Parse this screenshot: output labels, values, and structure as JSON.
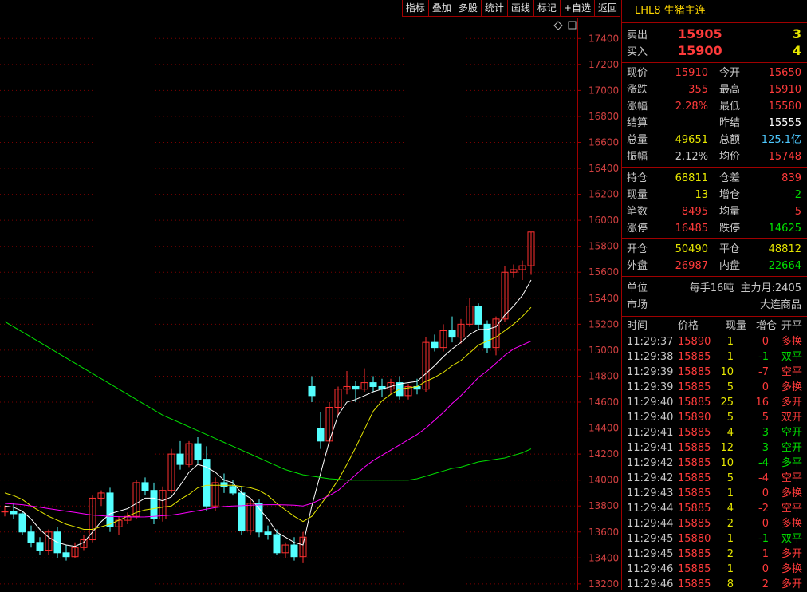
{
  "toolbar": [
    "指标",
    "叠加",
    "多股",
    "统计",
    "画线",
    "标记",
    "+自选",
    "返回"
  ],
  "chart": {
    "price_ticks": [
      "17400",
      "17200",
      "17000",
      "16800",
      "16600",
      "16400",
      "16200",
      "16000",
      "15800",
      "15600",
      "15400",
      "15200",
      "15000",
      "14800",
      "14600",
      "14400",
      "14200",
      "14000",
      "13800",
      "13600",
      "13400",
      "13200"
    ],
    "icons": [
      "diamond-icon",
      "square-icon"
    ],
    "colors": {
      "up": "#ff3030",
      "down": "#54ffff",
      "ma5": "#ffffff",
      "ma10": "#e6e600",
      "ma20": "#ff00ff",
      "ma60": "#00e000"
    }
  },
  "chart_data": {
    "type": "candlestick",
    "ylim": [
      13150,
      17500
    ],
    "candles": [
      [
        13760,
        13800,
        13720,
        13760
      ],
      [
        13760,
        13820,
        13700,
        13740
      ],
      [
        13740,
        13760,
        13580,
        13600
      ],
      [
        13600,
        13650,
        13480,
        13520
      ],
      [
        13520,
        13560,
        13420,
        13460
      ],
      [
        13460,
        13620,
        13420,
        13600
      ],
      [
        13600,
        13640,
        13400,
        13440
      ],
      [
        13440,
        13500,
        13380,
        13410
      ],
      [
        13410,
        13520,
        13400,
        13480
      ],
      [
        13480,
        13580,
        13460,
        13540
      ],
      [
        13540,
        13880,
        13520,
        13860
      ],
      [
        13860,
        13920,
        13800,
        13900
      ],
      [
        13900,
        13940,
        13600,
        13640
      ],
      [
        13640,
        13720,
        13580,
        13690
      ],
      [
        13690,
        13750,
        13660,
        13720
      ],
      [
        13720,
        14000,
        13700,
        13980
      ],
      [
        13980,
        14020,
        13880,
        13920
      ],
      [
        13920,
        13980,
        13660,
        13700
      ],
      [
        13700,
        13950,
        13680,
        13920
      ],
      [
        13920,
        14240,
        13900,
        14200
      ],
      [
        14200,
        14300,
        14080,
        14120
      ],
      [
        14120,
        14300,
        14100,
        14280
      ],
      [
        14280,
        14330,
        14120,
        14160
      ],
      [
        14160,
        14260,
        13760,
        13800
      ],
      [
        13800,
        14020,
        13760,
        13980
      ],
      [
        13980,
        14050,
        13900,
        13950
      ],
      [
        13950,
        14000,
        13880,
        13900
      ],
      [
        13900,
        13950,
        13580,
        13610
      ],
      [
        13610,
        13860,
        13580,
        13820
      ],
      [
        13820,
        13850,
        13560,
        13600
      ],
      [
        13600,
        13650,
        13540,
        13580
      ],
      [
        13580,
        13620,
        13420,
        13440
      ],
      [
        13440,
        13520,
        13400,
        13500
      ],
      [
        13500,
        13560,
        13380,
        13410
      ],
      [
        13410,
        13600,
        13360,
        13560
      ],
      [
        14720,
        14800,
        14600,
        14650
      ],
      [
        14400,
        14520,
        14240,
        14300
      ],
      [
        14300,
        14600,
        14280,
        14560
      ],
      [
        14560,
        14720,
        14500,
        14700
      ],
      [
        14700,
        14840,
        14660,
        14720
      ],
      [
        14720,
        14760,
        14600,
        14700
      ],
      [
        14700,
        14860,
        14680,
        14750
      ],
      [
        14750,
        14800,
        14680,
        14720
      ],
      [
        14720,
        14780,
        14640,
        14700
      ],
      [
        14700,
        14780,
        14660,
        14750
      ],
      [
        14750,
        14800,
        14620,
        14650
      ],
      [
        14650,
        14740,
        14620,
        14720
      ],
      [
        14720,
        14780,
        14660,
        14700
      ],
      [
        14700,
        15100,
        14680,
        15060
      ],
      [
        15060,
        15120,
        14990,
        15020
      ],
      [
        15020,
        15200,
        14990,
        15150
      ],
      [
        15150,
        15260,
        15060,
        15100
      ],
      [
        15100,
        15240,
        15050,
        15200
      ],
      [
        15200,
        15400,
        15180,
        15340
      ],
      [
        15340,
        15360,
        15160,
        15200
      ],
      [
        15200,
        15230,
        14980,
        15020
      ],
      [
        15020,
        15260,
        14960,
        15240
      ],
      [
        15240,
        15650,
        15220,
        15600
      ],
      [
        15600,
        15660,
        15560,
        15620
      ],
      [
        15620,
        15690,
        15540,
        15650
      ],
      [
        15650,
        15910,
        15580,
        15910
      ]
    ],
    "ma_series": [
      {
        "values": [
          13800,
          13790,
          13760,
          13700,
          13620,
          13560,
          13520,
          13500,
          13490,
          13520,
          13600,
          13680,
          13740,
          13760,
          13780,
          13820,
          13860,
          13860,
          13840,
          13870,
          13960,
          14060,
          14120,
          14100,
          14060,
          14000,
          13980,
          13900,
          13860,
          13780,
          13700,
          13600,
          13560,
          13520,
          13500,
          13800,
          14050,
          14300,
          14500,
          14600,
          14620,
          14650,
          14680,
          14700,
          14720,
          14740,
          14750,
          14760,
          14820,
          14880,
          14950,
          15010,
          15060,
          15120,
          15160,
          15160,
          15180,
          15270,
          15340,
          15420,
          15540
        ]
      },
      {
        "values": [
          13900,
          13880,
          13850,
          13800,
          13760,
          13720,
          13690,
          13660,
          13640,
          13620,
          13620,
          13640,
          13660,
          13690,
          13720,
          13750,
          13770,
          13780,
          13790,
          13800,
          13850,
          13890,
          13940,
          13960,
          13960,
          13960,
          13960,
          13950,
          13940,
          13920,
          13880,
          13820,
          13770,
          13720,
          13680,
          13720,
          13810,
          13900,
          14000,
          14120,
          14250,
          14390,
          14530,
          14610,
          14660,
          14700,
          14710,
          14720,
          14760,
          14790,
          14830,
          14880,
          14920,
          14980,
          15040,
          15070,
          15100,
          15150,
          15200,
          15260,
          15330
        ]
      },
      {
        "values": [
          13820,
          13815,
          13810,
          13800,
          13790,
          13780,
          13770,
          13760,
          13750,
          13740,
          13730,
          13725,
          13720,
          13718,
          13716,
          13715,
          13716,
          13720,
          13725,
          13730,
          13740,
          13752,
          13764,
          13776,
          13788,
          13796,
          13800,
          13802,
          13806,
          13808,
          13810,
          13810,
          13808,
          13806,
          13800,
          13820,
          13850,
          13880,
          13920,
          13980,
          14040,
          14100,
          14150,
          14190,
          14230,
          14270,
          14310,
          14350,
          14400,
          14460,
          14520,
          14590,
          14650,
          14720,
          14790,
          14840,
          14900,
          14960,
          15010,
          15040,
          15070
        ]
      },
      {
        "values": [
          15220,
          15180,
          15140,
          15100,
          15060,
          15020,
          14980,
          14940,
          14900,
          14860,
          14820,
          14780,
          14740,
          14700,
          14660,
          14620,
          14580,
          14540,
          14500,
          14470,
          14440,
          14410,
          14380,
          14350,
          14320,
          14290,
          14260,
          14230,
          14200,
          14170,
          14140,
          14110,
          14080,
          14060,
          14040,
          14030,
          14020,
          14010,
          14005,
          14000,
          14000,
          14000,
          14000,
          14000,
          14000,
          14000,
          14000,
          14010,
          14030,
          14050,
          14070,
          14090,
          14100,
          14120,
          14140,
          14150,
          14160,
          14170,
          14190,
          14210,
          14240
        ]
      }
    ]
  },
  "panel": {
    "title": "LHL8 生猪主连",
    "sell": {
      "label": "卖出",
      "price": "15905",
      "qty": "3"
    },
    "buy": {
      "label": "买入",
      "price": "15900",
      "qty": "4"
    },
    "quote_rows": [
      [
        {
          "t": "现价",
          "c": "lbl"
        },
        {
          "t": "15910",
          "c": "red"
        },
        {
          "t": "今开",
          "c": "lbl"
        },
        {
          "t": "15650",
          "c": "red"
        }
      ],
      [
        {
          "t": "涨跌",
          "c": "lbl"
        },
        {
          "t": "355",
          "c": "red"
        },
        {
          "t": "最高",
          "c": "lbl"
        },
        {
          "t": "15910",
          "c": "red"
        }
      ],
      [
        {
          "t": "涨幅",
          "c": "lbl"
        },
        {
          "t": "2.28%",
          "c": "red"
        },
        {
          "t": "最低",
          "c": "lbl"
        },
        {
          "t": "15580",
          "c": "red"
        }
      ],
      [
        {
          "t": "结算",
          "c": "lbl"
        },
        {
          "t": "",
          "c": "lbl"
        },
        {
          "t": "昨结",
          "c": "lbl"
        },
        {
          "t": "15555",
          "c": "white"
        }
      ],
      [
        {
          "t": "总量",
          "c": "lbl"
        },
        {
          "t": "49651",
          "c": "yellow"
        },
        {
          "t": "总额",
          "c": "lbl"
        },
        {
          "t": "125.1亿",
          "c": "cyan"
        }
      ],
      [
        {
          "t": "振幅",
          "c": "lbl"
        },
        {
          "t": "2.12%",
          "c": "lbl"
        },
        {
          "t": "均价",
          "c": "lbl"
        },
        {
          "t": "15748",
          "c": "red"
        }
      ]
    ],
    "pos_rows": [
      [
        {
          "t": "持仓",
          "c": "lbl"
        },
        {
          "t": "68811",
          "c": "yellow"
        },
        {
          "t": "仓差",
          "c": "lbl"
        },
        {
          "t": "839",
          "c": "red"
        }
      ],
      [
        {
          "t": "现量",
          "c": "lbl"
        },
        {
          "t": "13",
          "c": "yellow"
        },
        {
          "t": "增仓",
          "c": "lbl"
        },
        {
          "t": "-2",
          "c": "green"
        }
      ],
      [
        {
          "t": "笔数",
          "c": "lbl"
        },
        {
          "t": "8495",
          "c": "red"
        },
        {
          "t": "均量",
          "c": "lbl"
        },
        {
          "t": "5",
          "c": "red"
        }
      ],
      [
        {
          "t": "涨停",
          "c": "lbl"
        },
        {
          "t": "16485",
          "c": "red"
        },
        {
          "t": "跌停",
          "c": "lbl"
        },
        {
          "t": "14625",
          "c": "green"
        }
      ]
    ],
    "oc_rows": [
      [
        {
          "t": "开仓",
          "c": "lbl"
        },
        {
          "t": "50490",
          "c": "yellow"
        },
        {
          "t": "平仓",
          "c": "lbl"
        },
        {
          "t": "48812",
          "c": "yellow"
        }
      ],
      [
        {
          "t": "外盘",
          "c": "lbl"
        },
        {
          "t": "26987",
          "c": "red"
        },
        {
          "t": "内盘",
          "c": "lbl"
        },
        {
          "t": "22664",
          "c": "green"
        }
      ]
    ],
    "unit": {
      "label": "单位",
      "value": "每手16吨  主力月:2405"
    },
    "market": {
      "label": "市场",
      "value": "大连商品"
    },
    "tick_headers": [
      "时间",
      "价格",
      "现量",
      "增仓",
      "开平"
    ],
    "ticks": [
      {
        "time": "11:29:37",
        "price": "15890",
        "qty": "1",
        "chg": "0",
        "type": "多换",
        "pc": "red",
        "cc": "red",
        "tc": "red"
      },
      {
        "time": "11:29:38",
        "price": "15885",
        "qty": "1",
        "chg": "-1",
        "type": "双平",
        "pc": "red",
        "cc": "green",
        "tc": "green"
      },
      {
        "time": "11:29:39",
        "price": "15885",
        "qty": "10",
        "chg": "-7",
        "type": "空平",
        "pc": "red",
        "cc": "red",
        "tc": "red"
      },
      {
        "time": "11:29:39",
        "price": "15885",
        "qty": "5",
        "chg": "0",
        "type": "多换",
        "pc": "red",
        "cc": "red",
        "tc": "red"
      },
      {
        "time": "11:29:40",
        "price": "15885",
        "qty": "25",
        "chg": "16",
        "type": "多开",
        "pc": "red",
        "cc": "red",
        "tc": "red"
      },
      {
        "time": "11:29:40",
        "price": "15890",
        "qty": "5",
        "chg": "5",
        "type": "双开",
        "pc": "red",
        "cc": "red",
        "tc": "red"
      },
      {
        "time": "11:29:41",
        "price": "15885",
        "qty": "4",
        "chg": "3",
        "type": "空开",
        "pc": "red",
        "cc": "green",
        "tc": "green"
      },
      {
        "time": "11:29:41",
        "price": "15885",
        "qty": "12",
        "chg": "3",
        "type": "空开",
        "pc": "red",
        "cc": "green",
        "tc": "green"
      },
      {
        "time": "11:29:42",
        "price": "15885",
        "qty": "10",
        "chg": "-4",
        "type": "多平",
        "pc": "red",
        "cc": "green",
        "tc": "green"
      },
      {
        "time": "11:29:42",
        "price": "15885",
        "qty": "5",
        "chg": "-4",
        "type": "空平",
        "pc": "red",
        "cc": "red",
        "tc": "red"
      },
      {
        "time": "11:29:43",
        "price": "15885",
        "qty": "1",
        "chg": "0",
        "type": "多换",
        "pc": "red",
        "cc": "red",
        "tc": "red"
      },
      {
        "time": "11:29:44",
        "price": "15885",
        "qty": "4",
        "chg": "-2",
        "type": "空平",
        "pc": "red",
        "cc": "red",
        "tc": "red"
      },
      {
        "time": "11:29:44",
        "price": "15885",
        "qty": "2",
        "chg": "0",
        "type": "多换",
        "pc": "red",
        "cc": "red",
        "tc": "red"
      },
      {
        "time": "11:29:45",
        "price": "15880",
        "qty": "1",
        "chg": "-1",
        "type": "双平",
        "pc": "red",
        "cc": "green",
        "tc": "green"
      },
      {
        "time": "11:29:45",
        "price": "15885",
        "qty": "2",
        "chg": "1",
        "type": "多开",
        "pc": "red",
        "cc": "red",
        "tc": "red"
      },
      {
        "time": "11:29:46",
        "price": "15885",
        "qty": "1",
        "chg": "0",
        "type": "多换",
        "pc": "red",
        "cc": "red",
        "tc": "red"
      },
      {
        "time": "11:29:46",
        "price": "15885",
        "qty": "8",
        "chg": "2",
        "type": "多开",
        "pc": "red",
        "cc": "red",
        "tc": "red"
      }
    ]
  }
}
